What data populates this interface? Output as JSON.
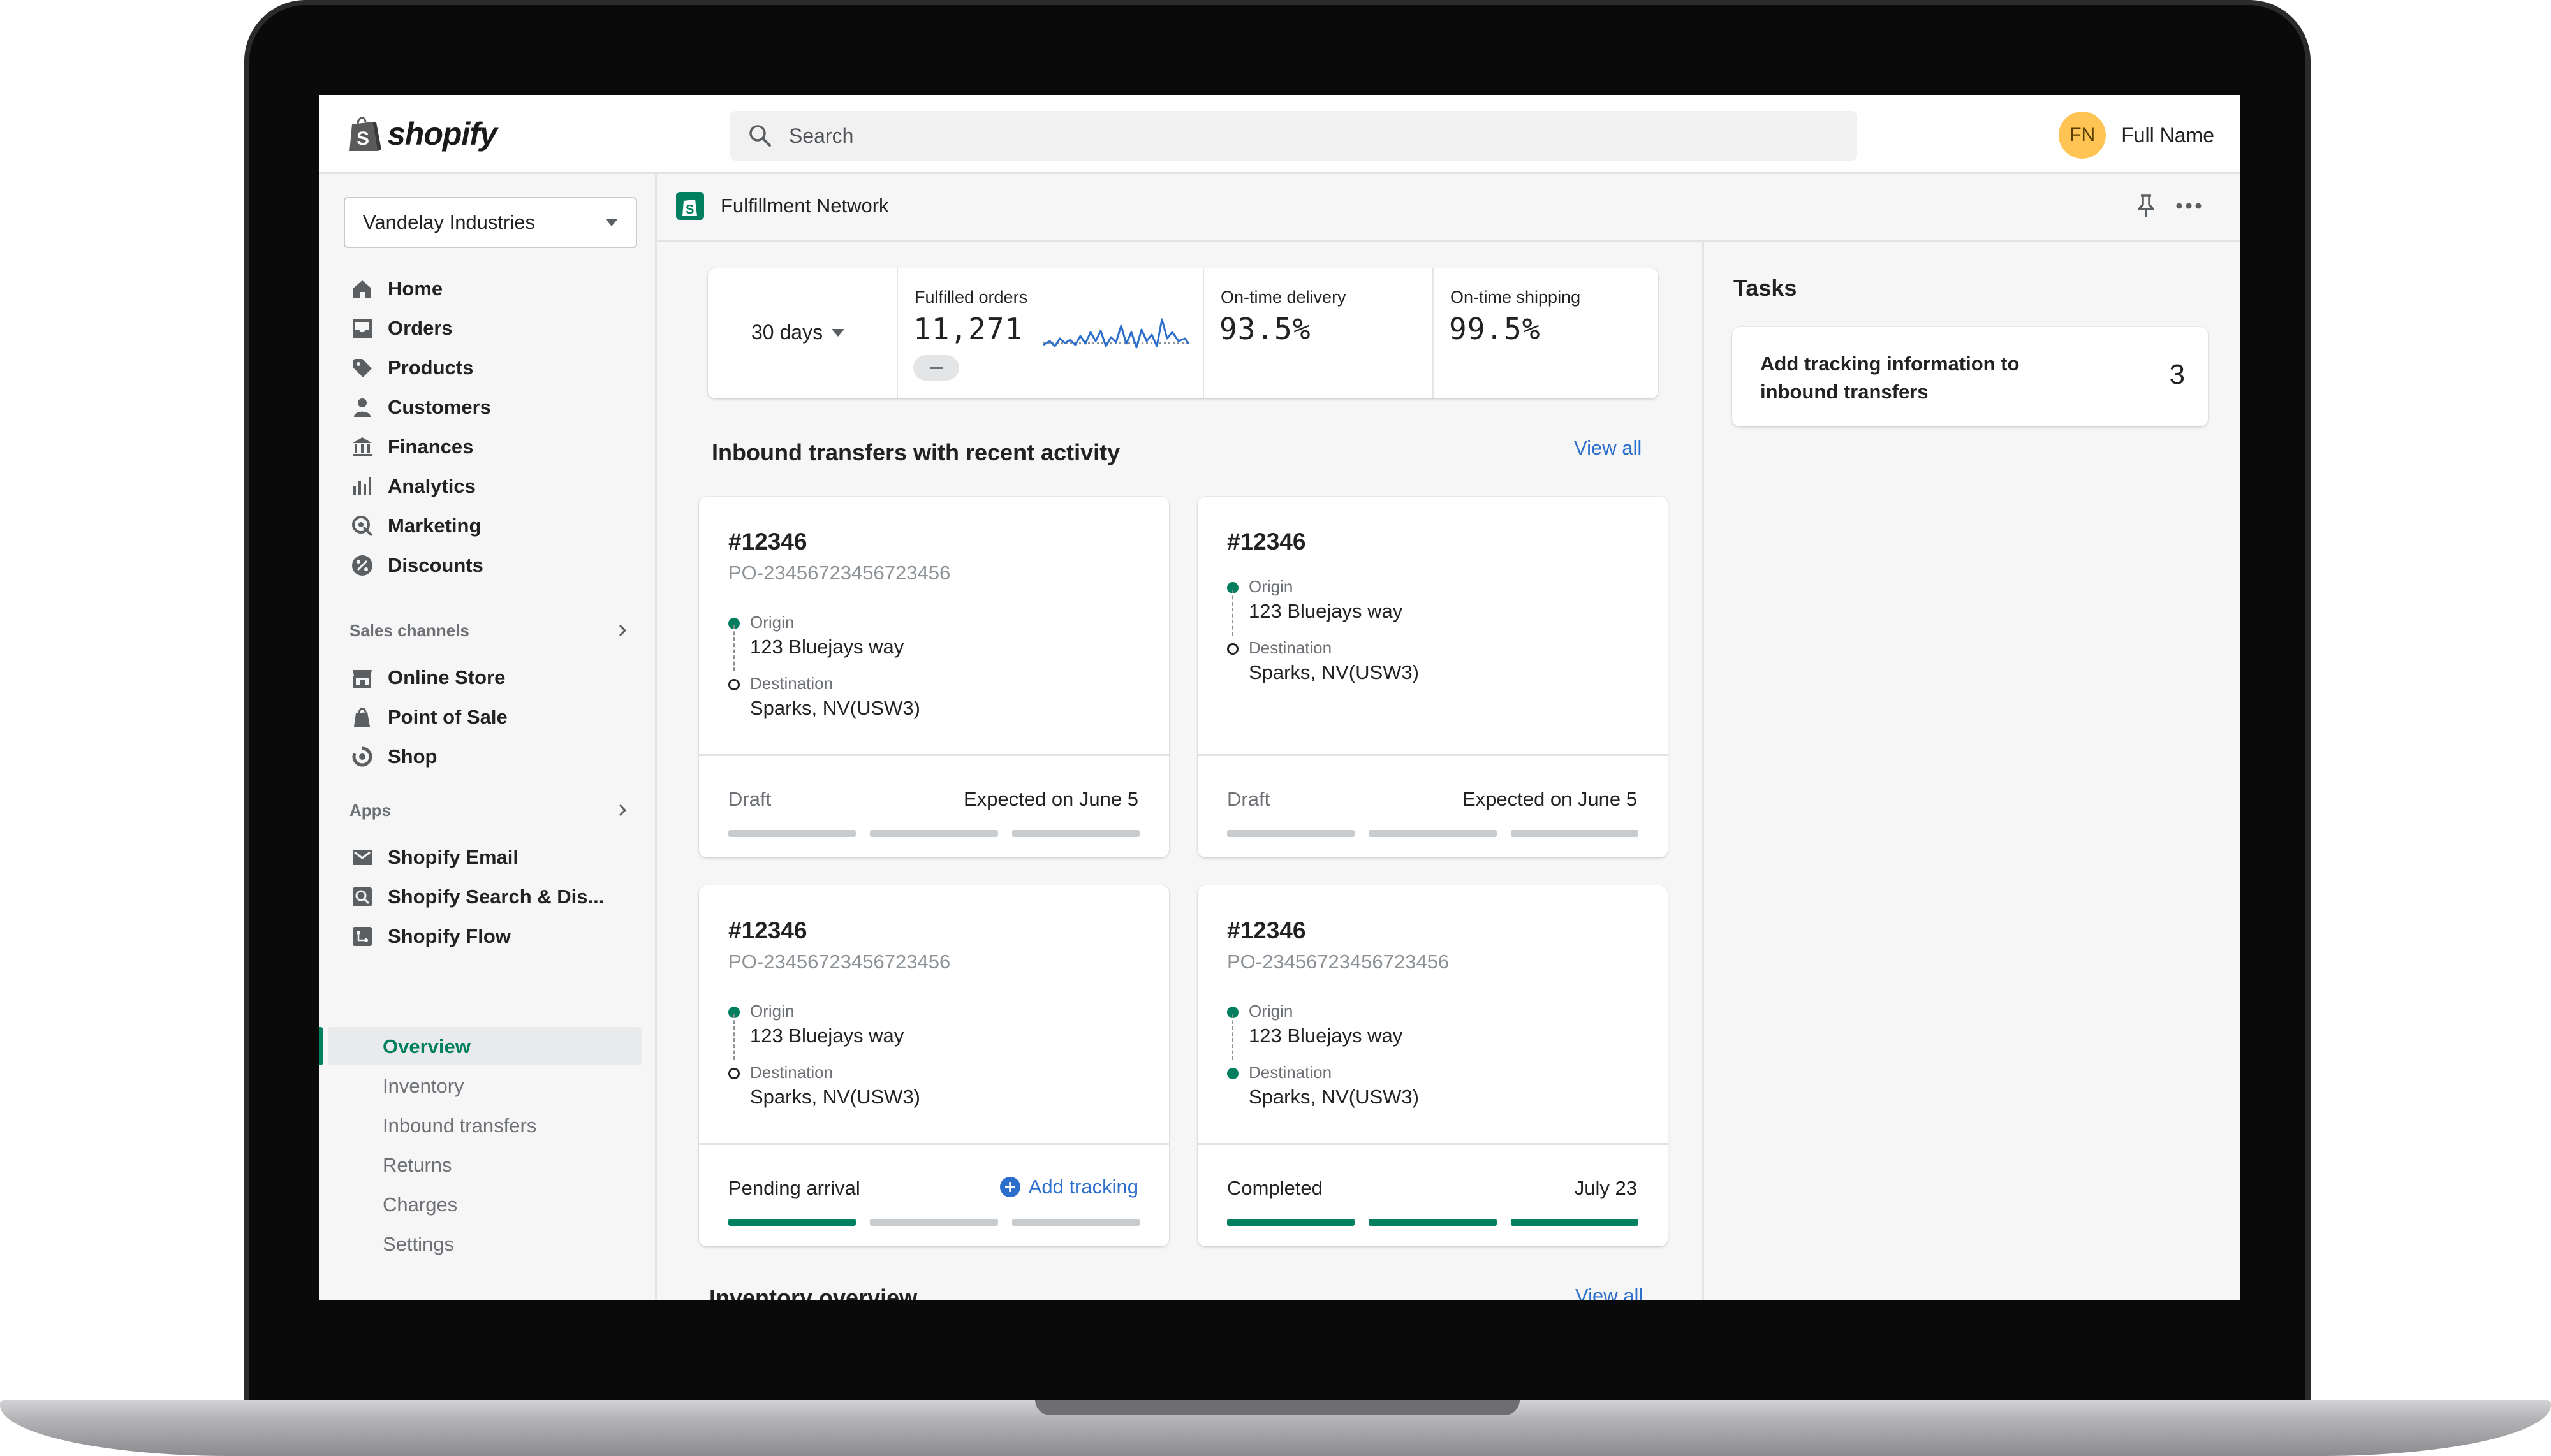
{
  "brand": {
    "name": "shopify",
    "accent": "#008060",
    "link": "#2c6ecb",
    "avatar_bg": "#ffc453"
  },
  "topbar": {
    "search_placeholder": "Search",
    "user_initials": "FN",
    "user_name": "Full Name"
  },
  "sidebar": {
    "store": "Vandelay Industries",
    "items": [
      {
        "label": "Home",
        "icon": "home-icon"
      },
      {
        "label": "Orders",
        "icon": "inbox-icon"
      },
      {
        "label": "Products",
        "icon": "tag-icon"
      },
      {
        "label": "Customers",
        "icon": "person-icon"
      },
      {
        "label": "Finances",
        "icon": "bank-icon"
      },
      {
        "label": "Analytics",
        "icon": "bar-chart-icon"
      },
      {
        "label": "Marketing",
        "icon": "target-icon"
      },
      {
        "label": "Discounts",
        "icon": "percent-icon"
      }
    ],
    "sales_channels_heading": "Sales channels",
    "sales_channels": [
      {
        "label": "Online Store",
        "icon": "store-icon"
      },
      {
        "label": "Point of Sale",
        "icon": "pos-icon"
      },
      {
        "label": "Shop",
        "icon": "shop-icon"
      }
    ],
    "apps_heading": "Apps",
    "apps": [
      {
        "label": "Shopify Email",
        "icon": "email-icon"
      },
      {
        "label": "Shopify Search & Dis...",
        "icon": "search-app-icon"
      },
      {
        "label": "Shopify Flow",
        "icon": "flow-icon"
      }
    ],
    "sub_items": [
      "Overview",
      "Inventory",
      "Inbound transfers",
      "Returns",
      "Charges",
      "Settings"
    ],
    "active_sub_item": "Overview"
  },
  "app_header": {
    "title": "Fulfillment Network"
  },
  "stats": {
    "range": "30 days",
    "fulfilled_label": "Fulfilled orders",
    "fulfilled_value": "11,271",
    "ontime_delivery_label": "On-time delivery",
    "ontime_delivery_value": "93.5%",
    "ontime_shipping_label": "On-time shipping",
    "ontime_shipping_value": "99.5%"
  },
  "transfers": {
    "title": "Inbound transfers with recent activity",
    "view_all": "View all",
    "cards": [
      {
        "id": "#12346",
        "po": "PO-23456723456723456",
        "origin_label": "Origin",
        "origin": "123 Bluejays way",
        "dest_label": "Destination",
        "dest": "Sparks, NV(USW3)",
        "status": "Draft",
        "right_text": "Expected on June 5",
        "progress_segments": 0
      },
      {
        "id": "#12346",
        "po": "",
        "origin_label": "Origin",
        "origin": "123 Bluejays way",
        "dest_label": "Destination",
        "dest": "Sparks, NV(USW3)",
        "status": "Draft",
        "right_text": "Expected on June 5",
        "progress_segments": 0
      },
      {
        "id": "#12346",
        "po": "PO-23456723456723456",
        "origin_label": "Origin",
        "origin": "123 Bluejays way",
        "dest_label": "Destination",
        "dest": "Sparks, NV(USW3)",
        "status": "Pending arrival",
        "action": "Add tracking",
        "progress_segments": 1
      },
      {
        "id": "#12346",
        "po": "PO-23456723456723456",
        "origin_label": "Origin",
        "origin": "123 Bluejays way",
        "dest_label": "Destination",
        "dest": "Sparks, NV(USW3)",
        "status": "Completed",
        "right_text": "July 23",
        "progress_segments": 3
      }
    ]
  },
  "inventory": {
    "title": "Inventory overview",
    "view_all": "View all"
  },
  "tasks": {
    "title": "Tasks",
    "items": [
      {
        "text": "Add tracking information to inbound transfers",
        "count": "3"
      }
    ]
  }
}
